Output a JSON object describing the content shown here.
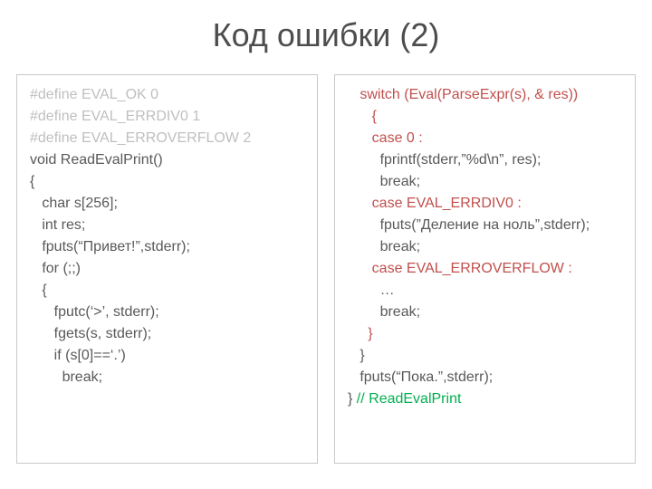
{
  "title": "Код ошибки (2)",
  "left": {
    "l0": "#define EVAL_OK 0",
    "l1": "#define EVAL_ERRDIV0 1",
    "l2": "#define EVAL_ERROVERFLOW 2",
    "l3": "",
    "l4": "void ReadEvalPrint()",
    "l5": "{",
    "l6": "   char s[256];",
    "l7": "   int res;",
    "l8": "   fputs(“Привет!”,stderr);",
    "l9": "   for (;;)",
    "l10": "   {",
    "l11": "      fputc(‘>’, stderr);",
    "l12": "      fgets(s, stderr);",
    "l13": "      if (s[0]==‘.’)",
    "l14": "        break;"
  },
  "right": {
    "r0": "   switch (Eval(ParseExpr(s), & res))",
    "r1": "      {",
    "r2": "      case 0 :",
    "r3": "        fprintf(stderr,”%d\\n”, res);",
    "r4": "        break;",
    "r5": "      case EVAL_ERRDIV0 :",
    "r6": "        fputs(”Деление на ноль”,stderr);",
    "r7": "        break;",
    "r8": "      case EVAL_ERROVERFLOW :",
    "r9": "        …",
    "r10": "        break;",
    "r11": "     }",
    "r12": "   }",
    "r13": "   fputs(“Пока.”,stderr);",
    "r14a": "} ",
    "r14b": "// ReadEvalPrint"
  }
}
